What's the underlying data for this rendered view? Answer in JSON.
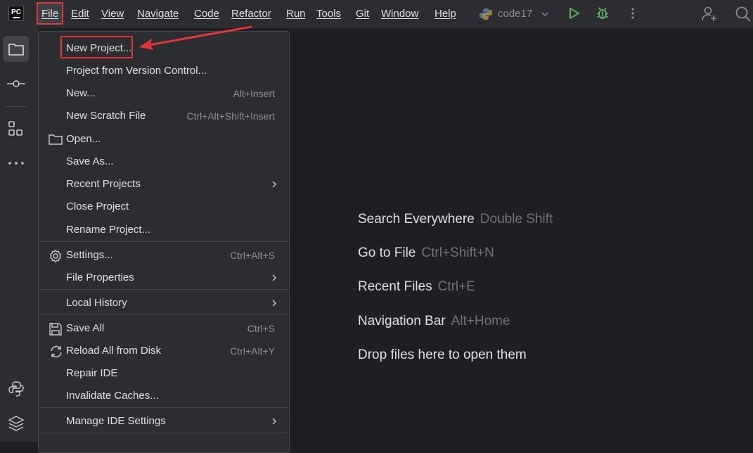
{
  "app": {
    "logo_text": "PC",
    "run_config": "code17"
  },
  "menubar": {
    "items": [
      "File",
      "Edit",
      "View",
      "Navigate",
      "Code",
      "Refactor",
      "Run",
      "Tools",
      "Git",
      "Window",
      "Help"
    ]
  },
  "file_menu": {
    "new_project": "New Project...",
    "project_from_vcs": "Project from Version Control...",
    "new": "New...",
    "new_shortcut": "Alt+Insert",
    "new_scratch": "New Scratch File",
    "new_scratch_shortcut": "Ctrl+Alt+Shift+Insert",
    "open": "Open...",
    "save_as": "Save As...",
    "recent_projects": "Recent Projects",
    "close_project": "Close Project",
    "rename_project": "Rename Project...",
    "settings": "Settings...",
    "settings_shortcut": "Ctrl+Alt+S",
    "file_properties": "File Properties",
    "local_history": "Local History",
    "save_all": "Save All",
    "save_all_shortcut": "Ctrl+S",
    "reload_all": "Reload All from Disk",
    "reload_all_shortcut": "Ctrl+Alt+Y",
    "repair_ide": "Repair IDE",
    "invalidate_caches": "Invalidate Caches...",
    "manage_ide_settings": "Manage IDE Settings"
  },
  "welcome_hints": [
    {
      "label": "Search Everywhere",
      "key": "Double Shift"
    },
    {
      "label": "Go to File",
      "key": "Ctrl+Shift+N"
    },
    {
      "label": "Recent Files",
      "key": "Ctrl+E"
    },
    {
      "label": "Navigation Bar",
      "key": "Alt+Home"
    },
    {
      "label": "Drop files here to open them",
      "key": ""
    }
  ],
  "colors": {
    "background": "#1e1f22",
    "panel": "#2b2d30",
    "highlight_box": "#e0363a",
    "run_green": "#5fb865",
    "text": "#dfe1e5",
    "muted": "#8c8f96"
  },
  "icons": [
    "folder-icon",
    "commit-icon",
    "structure-icon",
    "more-icon",
    "python-icon",
    "layers-icon",
    "run-icon",
    "debug-icon",
    "add-user-icon",
    "search-icon",
    "gear-icon",
    "save-icon",
    "reload-icon"
  ]
}
